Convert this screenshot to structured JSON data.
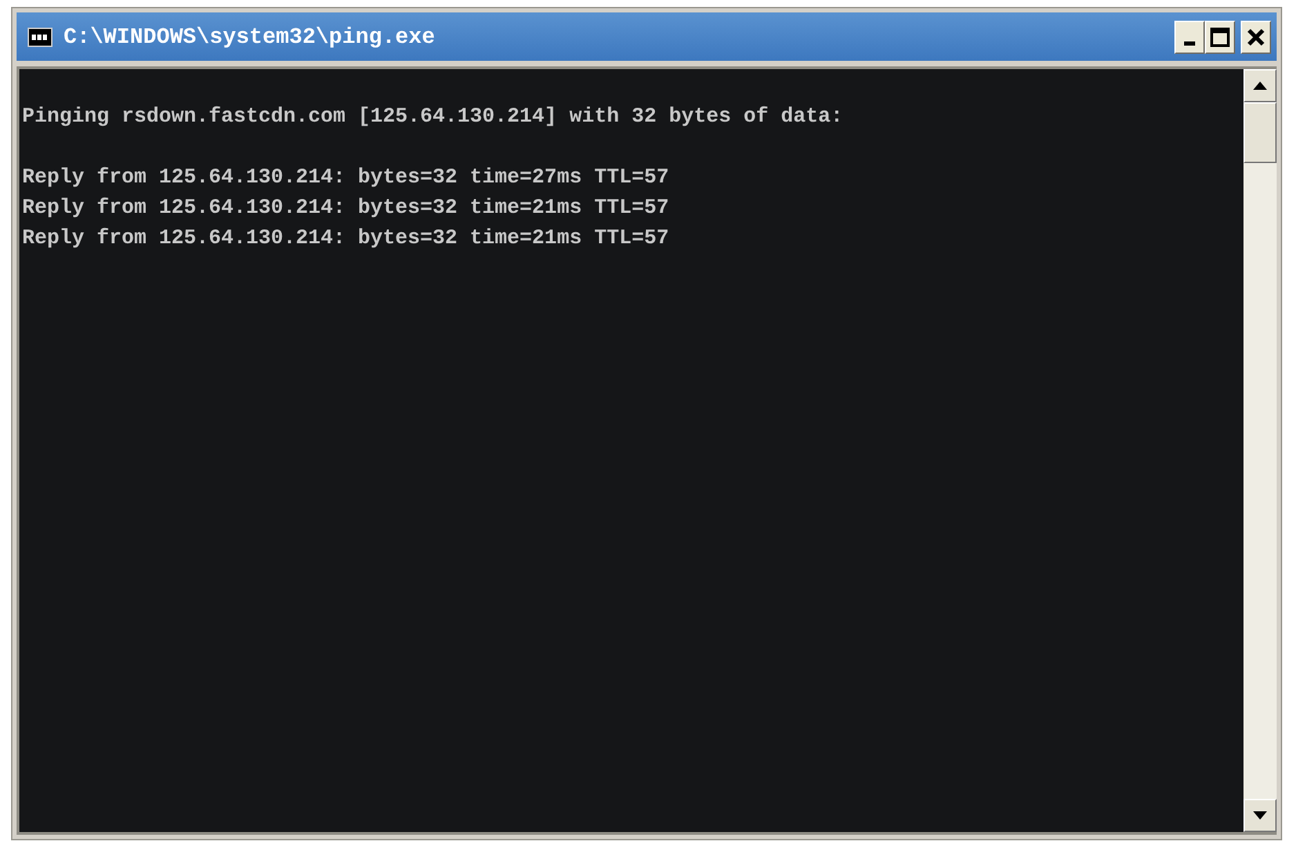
{
  "window": {
    "title": "C:\\WINDOWS\\system32\\ping.exe"
  },
  "console": {
    "paragraphs": [
      [
        "Pinging rsdown.fastcdn.com [125.64.130.214] with 32 bytes of data:"
      ],
      [
        "Reply from 125.64.130.214: bytes=32 time=27ms TTL=57",
        "Reply from 125.64.130.214: bytes=32 time=21ms TTL=57",
        "Reply from 125.64.130.214: bytes=32 time=21ms TTL=57"
      ]
    ]
  }
}
